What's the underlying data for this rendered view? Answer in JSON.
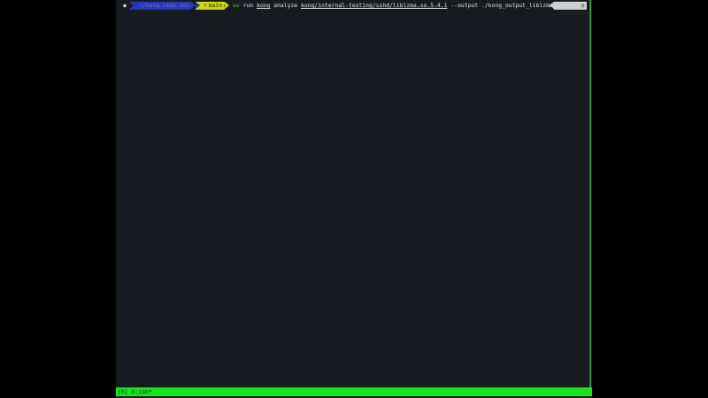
{
  "prompt": {
    "os_icon": "apple-icon",
    "directory": "~/kong-cmds-docs-build",
    "branch": "main",
    "branch_icon": "git-branch-icon",
    "dirty_marker": "●"
  },
  "command": {
    "exe": "uv",
    "arg1": "run",
    "arg2": "kong",
    "arg3": "analyze",
    "path": "kong/internal-testing/sshd/liblzma.so.5.4.1",
    "flag": "--output",
    "output": "./kong_output_liblzma"
  },
  "status": {
    "ok_symbol": "✔",
    "clock_icon": "clock-icon",
    "time": "22:13:37"
  },
  "tmux": {
    "session": "[0]",
    "window": "0:zsh*"
  },
  "colors": {
    "terminal_bg": "#171b1f",
    "dir_segment": "#2636b8",
    "git_segment": "#c9d614",
    "command_green": "#5fc25a",
    "tmux_bar": "#19e221",
    "time_segment": "#cfcfcf"
  }
}
